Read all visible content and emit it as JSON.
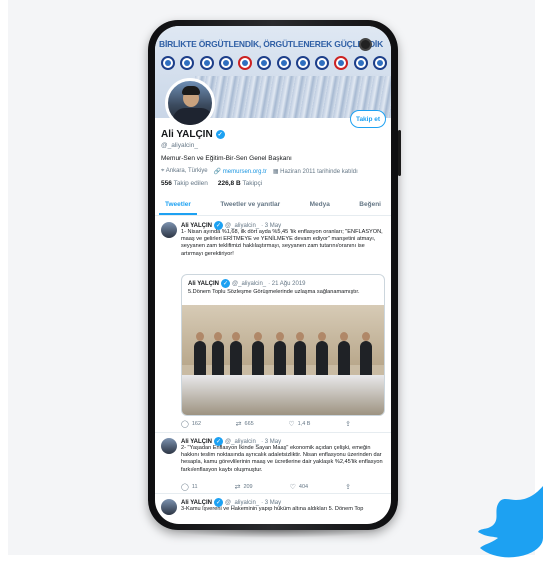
{
  "banner": {
    "title": "BİRLİKTE ÖRGÜTLENDİK, ÖRGÜTLENEREK GÜÇLENDİK"
  },
  "profile": {
    "follow_label": "Takip et",
    "name": "Ali YALÇIN",
    "handle": "@_aliyalcin_",
    "bio": "Memur-Sen ve Eğitim-Bir-Sen Genel Başkanı",
    "location": "Ankara, Türkiye",
    "website": "memursen.org.tr",
    "joined": "Haziran 2011 tarihinde katıldı",
    "following_count": "556",
    "following_label": "Takip edilen",
    "followers_count": "226,8 B",
    "followers_label": "Takipçi"
  },
  "tabs": [
    {
      "label": "Tweetler"
    },
    {
      "label": "Tweetler ve yanıtlar"
    },
    {
      "label": "Medya"
    },
    {
      "label": "Beğeni"
    }
  ],
  "tweets": [
    {
      "author": "Ali YALÇIN",
      "handle": "@_aliyalcin_",
      "date": "· 3 May",
      "text": "1- Nisan ayında %1,68, ilk dört ayda %5,45 'lik enflasyon oranları; \"ENFLASYON, maaş ve gelirleri ERİTMEYE ve YENİLMEYE devam ediyor\" manşetini atmayı, seyyanen zam teklifimizi haklılaştırmayı, seyyanen zam tutarını/oranını ise artırmayı gerektiriyor!",
      "quote": {
        "author": "Ali YALÇIN",
        "handle": "@_aliyalcin_",
        "date": "· 21 Ağu 2019",
        "text": "5.Dönem Toplu Sözleşme Görüşmelerinde uzlaşma sağlanamamıştır."
      },
      "replies": "162",
      "retweets": "665",
      "likes": "1,4 B"
    },
    {
      "author": "Ali YALÇIN",
      "handle": "@_aliyalcin_",
      "date": "· 3 May",
      "text": "2- \"Yaşadan Enflasyon İkinde Sayan Maaş\" ekonomik açıdan çelişki, emeğin hakkını teslim noktasında ayrıcalık adaletsizliktir. Nisan enflasyonu üzerinden dar hesapla, kamu görevlilerinin maaş ve ücretlerine dair yaklaşık %2,45'lik enflasyon farkı/enflasyon kaybı oluşmuştur.",
      "replies": "11",
      "retweets": "209",
      "likes": "404"
    },
    {
      "author": "Ali YALÇIN",
      "handle": "@_aliyalcin_",
      "date": "· 3 May",
      "text": "3-Kamu İşvereni ve Hakeminin yapıp hüküm altına aldıkları 5. Dönem Top"
    }
  ],
  "colors": {
    "twitter_blue": "#1da1f2",
    "phone_body": "#1a1a1c"
  }
}
